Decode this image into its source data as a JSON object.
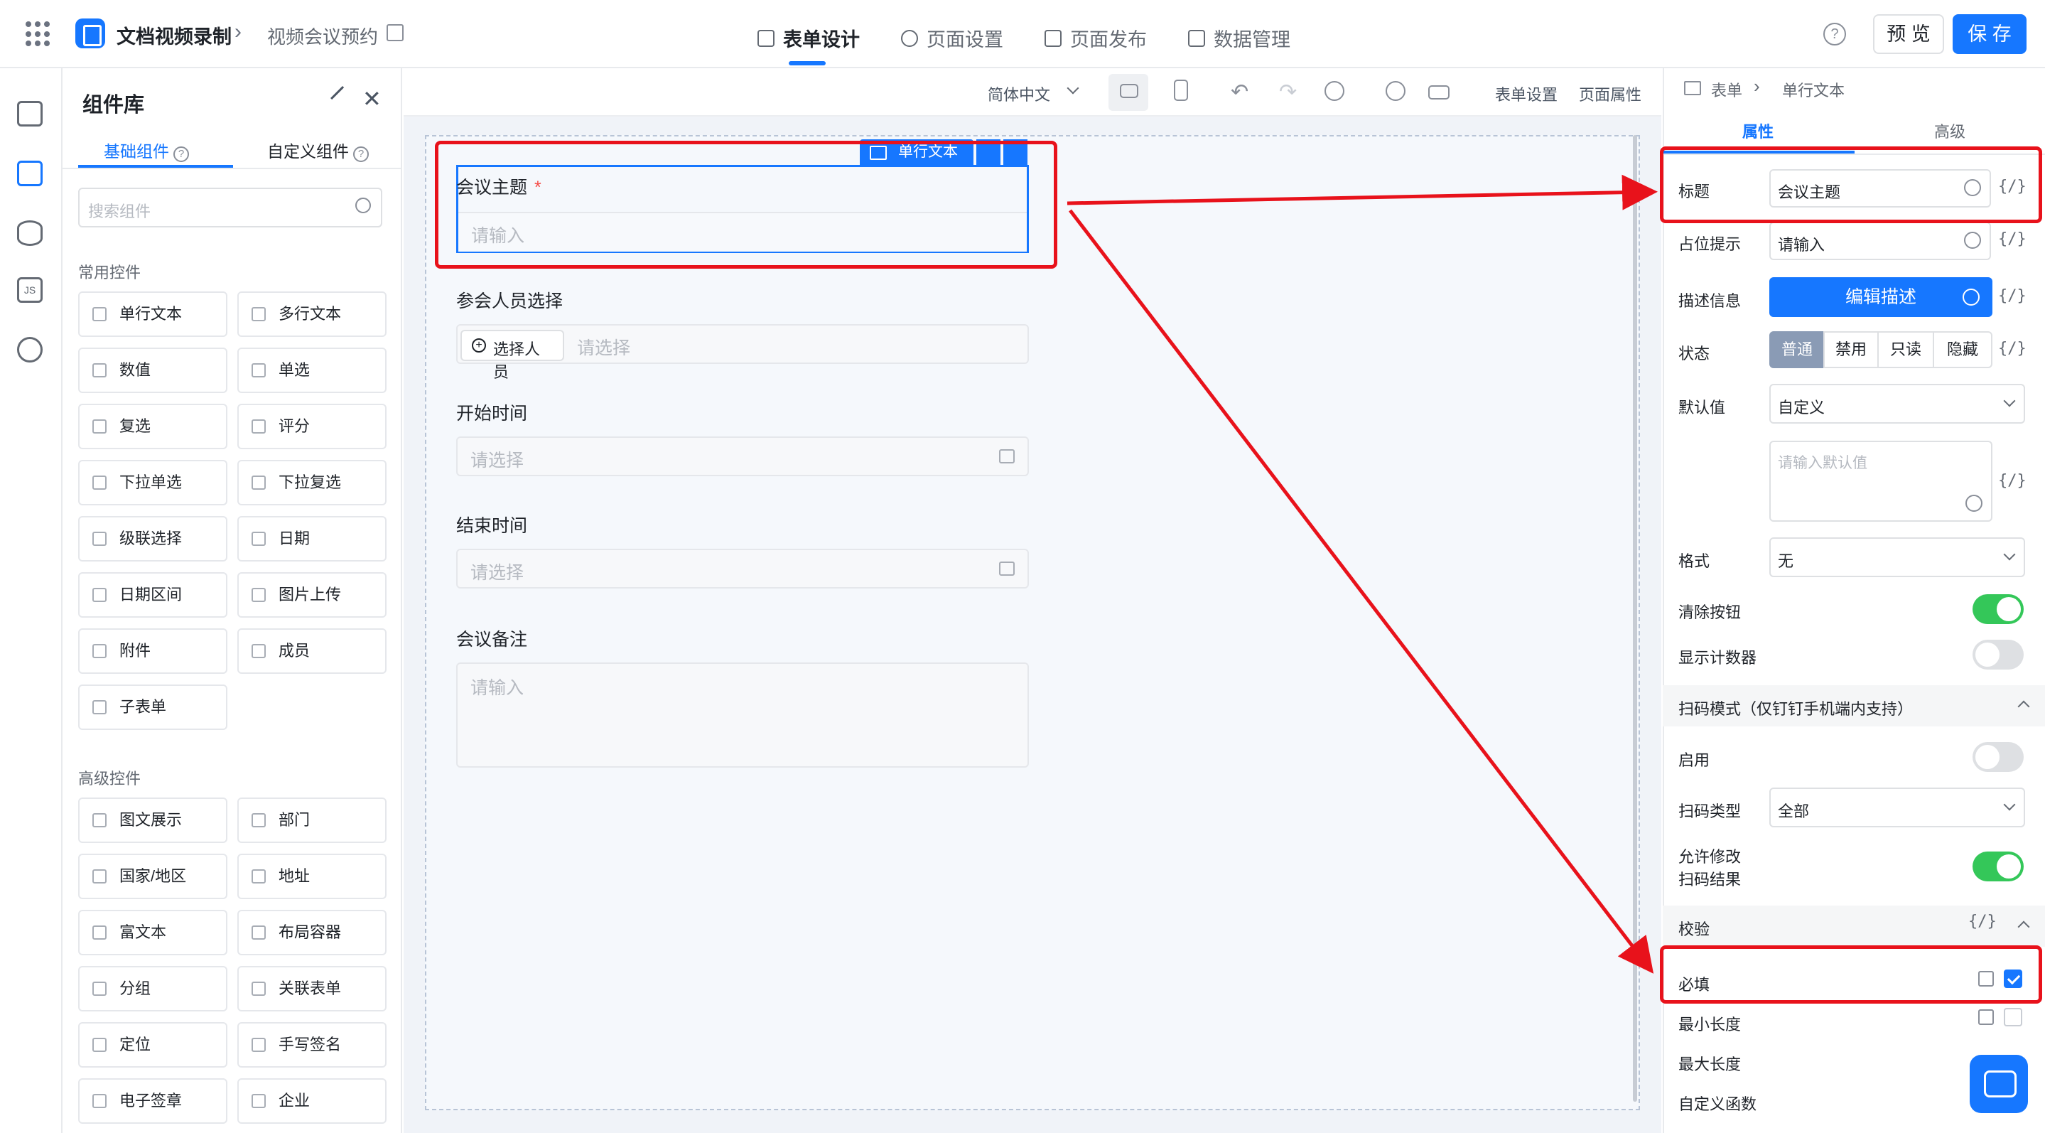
{
  "header": {
    "app_title": "文档视频录制",
    "page_name": "视频会议预约",
    "tabs": [
      {
        "label": "表单设计",
        "active": true
      },
      {
        "label": "页面设置"
      },
      {
        "label": "页面发布"
      },
      {
        "label": "数据管理"
      }
    ],
    "preview_label": "预 览",
    "save_label": "保 存"
  },
  "library": {
    "title": "组件库",
    "tabs": [
      "基础组件",
      "自定义组件"
    ],
    "search_placeholder": "搜索组件",
    "common_title": "常用控件",
    "common": [
      "单行文本",
      "多行文本",
      "数值",
      "单选",
      "复选",
      "评分",
      "下拉单选",
      "下拉复选",
      "级联选择",
      "日期",
      "日期区间",
      "图片上传",
      "附件",
      "成员",
      "子表单"
    ],
    "advanced_title": "高级控件",
    "advanced": [
      "图文展示",
      "部门",
      "国家/地区",
      "地址",
      "富文本",
      "布局容器",
      "分组",
      "关联表单",
      "定位",
      "手写签名",
      "电子签章",
      "企业"
    ]
  },
  "toolbar": {
    "language": "简体中文",
    "form_settings": "表单设置",
    "page_props": "页面属性"
  },
  "canvas": {
    "selected_tag": "单行文本",
    "fields": [
      {
        "label": "会议主题",
        "required_mark": "*",
        "placeholder": "请输入"
      },
      {
        "label": "参会人员选择",
        "button": "选择人员",
        "placeholder": "请选择"
      },
      {
        "label": "开始时间",
        "placeholder": "请选择"
      },
      {
        "label": "结束时间",
        "placeholder": "请选择"
      },
      {
        "label": "会议备注",
        "placeholder": "请输入"
      }
    ]
  },
  "props": {
    "breadcrumb": [
      "表单",
      "单行文本"
    ],
    "tabs": [
      "属性",
      "高级"
    ],
    "title_label": "标题",
    "title_value": "会议主题",
    "placeholder_label": "占位提示",
    "placeholder_value": "请输入",
    "desc_label": "描述信息",
    "desc_button": "编辑描述",
    "state_label": "状态",
    "states": [
      "普通",
      "禁用",
      "只读",
      "隐藏"
    ],
    "default_label": "默认值",
    "default_mode": "自定义",
    "default_placeholder": "请输入默认值",
    "format_label": "格式",
    "format_value": "无",
    "clear_label": "清除按钮",
    "counter_label": "显示计数器",
    "scan_section": "扫码模式（仅钉钉手机端内支持）",
    "enable_label": "启用",
    "scan_type_label": "扫码类型",
    "scan_type_value": "全部",
    "allow_edit_line1": "允许修改",
    "allow_edit_line2": "扫码结果",
    "validate_section": "校验",
    "required_label": "必填",
    "min_len_label": "最小长度",
    "max_len_label": "最大长度",
    "custom_fn_label": "自定义函数",
    "fx": "{/}"
  },
  "annotation_color": "#e8121b",
  "accent_color": "#1677ff"
}
